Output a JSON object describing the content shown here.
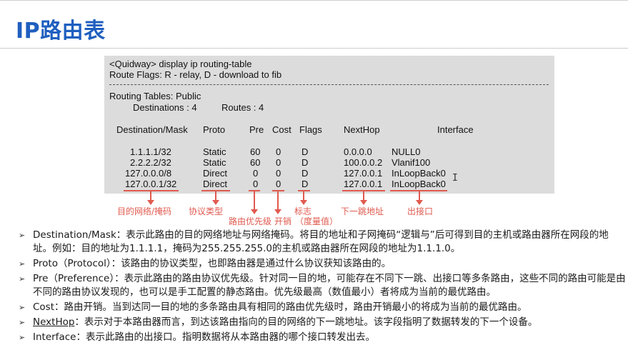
{
  "slide_title": "IP路由表",
  "terminal": {
    "lines": [
      "<Quidway> display ip routing-table",
      "Route Flags: R - relay, D - download to fib",
      "Routing Tables: Public",
      "Destinations : 4",
      "Routes : 4"
    ],
    "headers": [
      "Destination/Mask",
      "Proto",
      "Pre",
      "Cost",
      "Flags",
      "NextHop",
      "Interface"
    ],
    "rows": [
      [
        "1.1.1.1/32",
        "Static",
        "60",
        "0",
        "D",
        "0.0.0.0",
        "NULL0"
      ],
      [
        "2.2.2.2/32",
        "Static",
        "60",
        "0",
        "D",
        "100.0.0.2",
        "Vlanif100"
      ],
      [
        "127.0.0.0/8",
        "Direct",
        "0",
        "0",
        "D",
        "127.0.0.1",
        "InLoopBack0"
      ],
      [
        "127.0.0.1/32",
        "Direct",
        "0",
        "0",
        "D",
        "127.0.0.1",
        "InLoopBack0"
      ]
    ]
  },
  "annotations": {
    "dest": "目的网络/掩码",
    "proto": "协议类型",
    "pre": "路由优先级",
    "cost": "开销",
    "flags_1": "标志",
    "flags_2": "（度量值）",
    "nexthop": "下一跳地址",
    "interface": "出接口"
  },
  "bullets": [
    {
      "term": "Destination/Mask",
      "text": "：表示此路由的目的网络地址与网络掩码。将目的地址和子网掩码“逻辑与”后可得到目的主机或路由器所在网段的地址。例如：目的地址为1.1.1.1，掩码为255.255.255.0的主机或路由器所在网段的地址为1.1.1.0。"
    },
    {
      "term": "Proto（Protocol）",
      "text": "：该路由的协议类型，也即路由器是通过什么协议获知该路由的。"
    },
    {
      "term": "Pre（Preference）",
      "text": "：表示此路由的路由协议优先级。针对同一目的地，可能存在不同下一跳、出接口等多条路由，这些不同的路由可能是由不同的路由协议发现的，也可以是手工配置的静态路由。优先级最高（数值最小）者将成为当前的最优路由。"
    },
    {
      "term": "Cost",
      "text": "：路由开销。当到达同一目的地的多条路由具有相同的路由优先级时，路由开销最小的将成为当前的最优路由。"
    },
    {
      "term": "NextHop",
      "text": "：表示对于本路由器而言，到达该路由指向的目的网络的下一跳地址。该字段指明了数据转发的下一个设备。"
    },
    {
      "term": "Interface",
      "text": "：表示此路由的出接口。指明数据将从本路由器的哪个接口转发出去。"
    }
  ],
  "colors": {
    "title": "#1f5fbf",
    "annotation": "#e05a4f",
    "panel": "#dcdcdc"
  }
}
